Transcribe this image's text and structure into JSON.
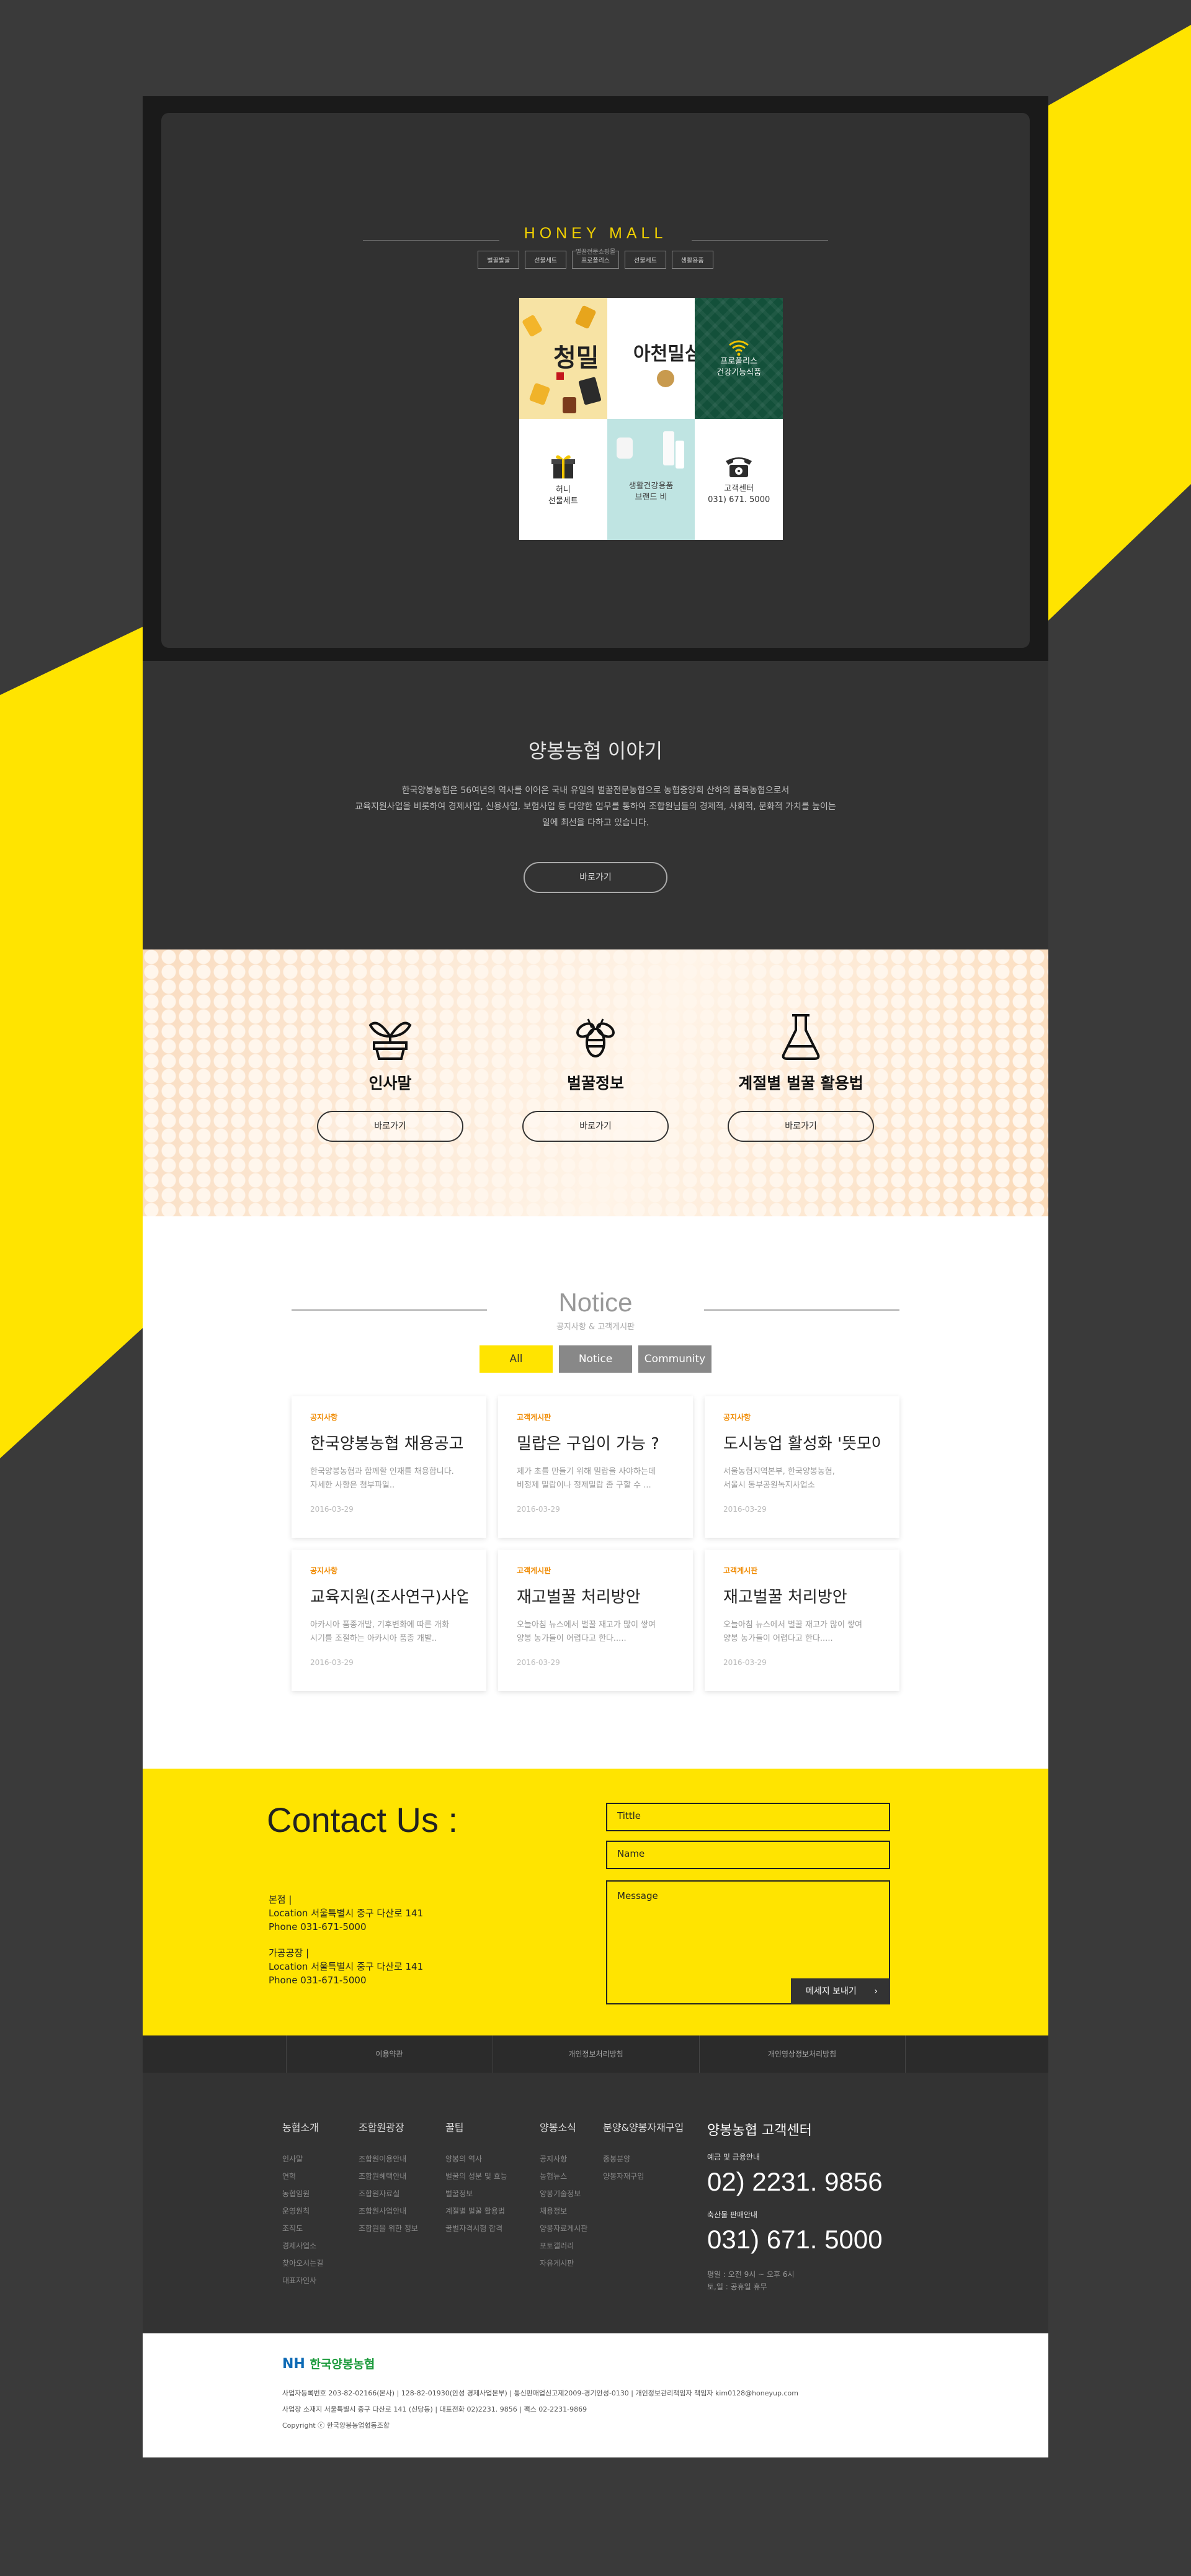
{
  "colors": {
    "accent_yellow": "#ffe400",
    "dark": "#333333",
    "brand_gold": "#f2d100",
    "card_category": "#f08a00"
  },
  "hero": {
    "brand_title": "HONEY MALL",
    "brand_sub": "벌꿀전문쇼핑몰",
    "menu": [
      "벌꿀발굴",
      "선물세트",
      "프로폴리스",
      "선물세트",
      "생활용품"
    ],
    "tiles": [
      {
        "icon": "honey-products-image",
        "label": "청밀"
      },
      {
        "icon": "calligraphy-image",
        "label": "아천밀심"
      },
      {
        "icon": "wifi-icon",
        "label_1": "프로폴리스",
        "label_2": "건강기능식품"
      },
      {
        "icon": "gift-icon",
        "label_1": "허니",
        "label_2": "선물세트"
      },
      {
        "icon": "cosmetics-image",
        "label_1": "생활건강용품",
        "label_2": "브랜드 비"
      },
      {
        "icon": "telephone-icon",
        "label_1": "고객센터",
        "label_2": "031) 671. 5000"
      }
    ]
  },
  "story": {
    "title": "양봉농협 이야기",
    "lines": [
      "한국양봉농협은 56여년의 역사를 이어온 국내 유일의 벌꿀전문농협으로 농협중앙회 산하의 품목농협으로서",
      "교육지원사업을 비롯하여 경제사업, 신용사업, 보험사업 등 다양한 업무를 통하여 조합원님들의 경제적, 사회적, 문화적 가치를 높이는",
      "일에 최선을 다하고 있습니다."
    ],
    "button": "바로가기"
  },
  "features": [
    {
      "icon": "plant-icon",
      "title": "인사말",
      "button": "바로가기"
    },
    {
      "icon": "bee-icon",
      "title": "벌꿀정보",
      "button": "바로가기"
    },
    {
      "icon": "flask-icon",
      "title": "계절별 벌꿀 활용법",
      "button": "바로가기"
    }
  ],
  "notice": {
    "title": "Notice",
    "sub": "공지사항 & 고객게시판",
    "filters": [
      "All",
      "Notice",
      "Community"
    ],
    "cards": [
      {
        "category": "공지사항",
        "title": "한국양봉농협 채용공고",
        "text_1": "한국양봉농협과 함께할 인재를 채용합니다.",
        "text_2": "자세한 사항은 첨부파일..",
        "date": "2016-03-29"
      },
      {
        "category": "고객게시판",
        "title": "밀랍은 구입이 가능 ?",
        "text_1": "제가 초를 만들기 위해 밀랍을 사야하는데",
        "text_2": "비정제 밀랍이나 정제밀랍 좀 구할 수 ...",
        "date": "2016-03-29"
      },
      {
        "category": "공지사항",
        "title": "도시농업 활성화 '뜻모아'",
        "text_1": "서울농협지역본부, 한국양봉농협,",
        "text_2": "서울시 동부공원녹지사업소",
        "date": "2016-03-29"
      },
      {
        "category": "공지사항",
        "title": "교육지원(조사연구)사업..",
        "text_1": "아카시아 품종개발, 기후변화에 따른 개화",
        "text_2": "시기를 조절하는 아카시아 품종 개발..",
        "date": "2016-03-29"
      },
      {
        "category": "고객게시판",
        "title": "재고벌꿀 처리방안",
        "text_1": "오늘아침 뉴스에서 벌꿀 재고가 많이 쌓여",
        "text_2": "양봉 농가들이 어렵다고 한다.....",
        "date": "2016-03-29"
      },
      {
        "category": "고객게시판",
        "title": "재고벌꿀 처리방안",
        "text_1": "오늘아침 뉴스에서 벌꿀 재고가 많이 쌓여",
        "text_2": "양봉 농가들이 어렵다고 한다.....",
        "date": "2016-03-29"
      }
    ]
  },
  "contact": {
    "title": "Contact Us :",
    "hq_label": "본점 |",
    "hq_location": "Location   서울특별시 중구 다산로 141",
    "hq_phone": "Phone   031-671-5000",
    "plant_label": "가공공장 |",
    "plant_location": "Location   서울특별시 중구 다산로 141",
    "plant_phone": "Phone   031-671-5000",
    "title_placeholder": "Tittle",
    "name_placeholder": "Name",
    "message_placeholder": "Message",
    "send_label": "메세지 보내기",
    "send_arrow": "›"
  },
  "policy": [
    "이용약관",
    "개인정보처리방침",
    "개인영상정보처리방침"
  ],
  "footer": {
    "columns": [
      {
        "title": "농협소개",
        "links": [
          "인사말",
          "연혁",
          "농협임원",
          "운영원칙",
          "조직도",
          "경제사업소",
          "찾아오시는길",
          "대표자인사"
        ]
      },
      {
        "title": "조합원광장",
        "links": [
          "조합원이용안내",
          "조합원혜택안내",
          "조합원자료실",
          "조합원사업안내",
          "조합원을 위한 정보"
        ]
      },
      {
        "title": "꿀팁",
        "links": [
          "양봉의 역사",
          "벌꿀의 성분 및 효능",
          "벌꿀정보",
          "계절별 벌꿀 활용법",
          "꿀벌자격시험 합격"
        ]
      },
      {
        "title": "양봉소식",
        "links": [
          "공지사항",
          "농협뉴스",
          "양봉기술정보",
          "채용정보",
          "양봉자료게시판",
          "포토갤러리",
          "자유게시판"
        ]
      },
      {
        "title": "분양&양봉자재구입",
        "links": [
          "종봉분양",
          "양봉자재구입"
        ]
      }
    ],
    "cs_title": "양봉농협 고객센터",
    "cs_label_1": "예금 및 금융안내",
    "cs_phone_1": "02) 2231. 9856",
    "cs_label_2": "축산물 판매안내",
    "cs_phone_2": "031) 671. 5000",
    "cs_hours_1": "평일 : 오전 9시 ~ 오후 6시",
    "cs_hours_2": "토,일 : 공휴일 휴무"
  },
  "bottom": {
    "logo_nh": "NH",
    "logo_name": "한국양봉농협",
    "line_1": "사업자등록번호 203-82-02166(본사) | 128-82-01930(안성 경제사업본부) | 통신판매업신고제2009-경기안성-0130 | 개인정보관리책임자 책임자 kim0128@honeyup.com",
    "line_2": "사업장 소재지 서울특별시 중구 다산로 141 (신당동) | 대표전화 02)2231. 9856 | 팩스 02-2231-9869",
    "line_3": "Copyright ⓒ 한국양봉농업협동조합"
  }
}
